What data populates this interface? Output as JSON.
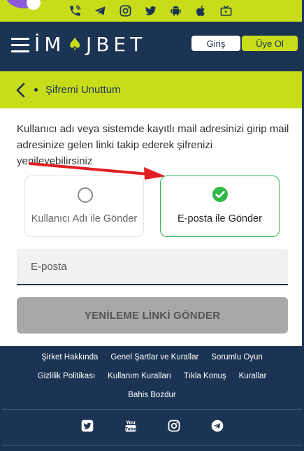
{
  "topbar": {
    "icons": [
      "phone-icon",
      "telegram-icon",
      "instagram-icon",
      "twitter-icon",
      "android-icon",
      "apple-icon",
      "tv-icon"
    ]
  },
  "header": {
    "logo_left": "İM",
    "logo_right": "JBET",
    "login_label": "Giriş",
    "register_label": "Üye Ol"
  },
  "page": {
    "title": "Şifremi Unuttum",
    "description": "Kullanıcı adı veya sistemde kayıtlı mail adresinizi girip mail adresinize gelen linki takip ederek şifrenizi yenileyebilirsiniz",
    "option_username": "Kullanıcı Adı ile Gönder",
    "option_email": "E-posta ile Gönder",
    "selected_option": "email",
    "email_placeholder": "E-posta",
    "email_value": "",
    "submit_label": "YENİLEME LİNKİ GÖNDER"
  },
  "colors": {
    "accent": "#c8dd1a",
    "navy": "#1c3453",
    "success": "#32b74a",
    "annotation_arrow": "#e31e24"
  },
  "footer": {
    "links_row1": [
      "Şirket Hakkında",
      "Genel Şartlar ve Kurallar",
      "Sorumlu Oyun"
    ],
    "links_row2": [
      "Gizlilik Politikası",
      "Kullanım Kuralları",
      "Tıkla Konuş",
      "Kurallar"
    ],
    "links_row3": [
      "Bahis Bozdur"
    ],
    "social": [
      "twitter-icon",
      "youtube-icon",
      "instagram-icon",
      "telegram-icon"
    ]
  }
}
